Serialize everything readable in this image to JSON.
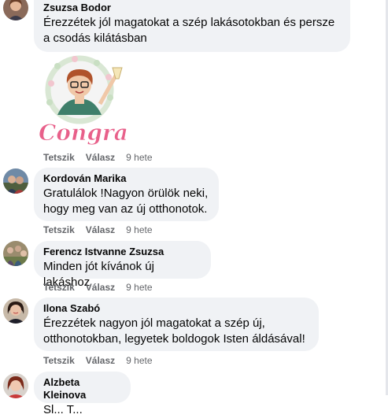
{
  "comments": [
    {
      "author": "Zsuzsa Bodor",
      "text": "Érezzétek jól magatokat a szép lakásotokban és persze a csodás kilátásban",
      "sticker_text": "Congrats!",
      "actions": {
        "like": "Tetszik",
        "reply": "Válasz",
        "time": "9 hete"
      }
    },
    {
      "author": "Kordován Marika",
      "text": "Gratulálok !Nagyon örülök neki, hogy meg van az új otthonotok.",
      "actions": {
        "like": "Tetszik",
        "reply": "Válasz",
        "time": "9 hete"
      }
    },
    {
      "author": "Ferencz Istvanne Zsuzsa",
      "text": "Minden jót kívánok új lakáshoz",
      "actions": {
        "like": "Tetszik",
        "reply": "Válasz",
        "time": "9 hete"
      }
    },
    {
      "author": "Ilona Szabó",
      "text": "Érezzétek nagyon jól magatokat a szép új, otthonotokban, legyetek boldogok Isten áldásával!",
      "actions": {
        "like": "Tetszik",
        "reply": "Válasz",
        "time": "9 hete"
      }
    },
    {
      "author": "Alzbeta Kleinova",
      "text": "Sl... T...",
      "actions": {}
    }
  ],
  "colors": {
    "bubble_bg": "#f0f2f5",
    "meta_text": "#65676b",
    "sticker_pink": "#e8608a"
  }
}
